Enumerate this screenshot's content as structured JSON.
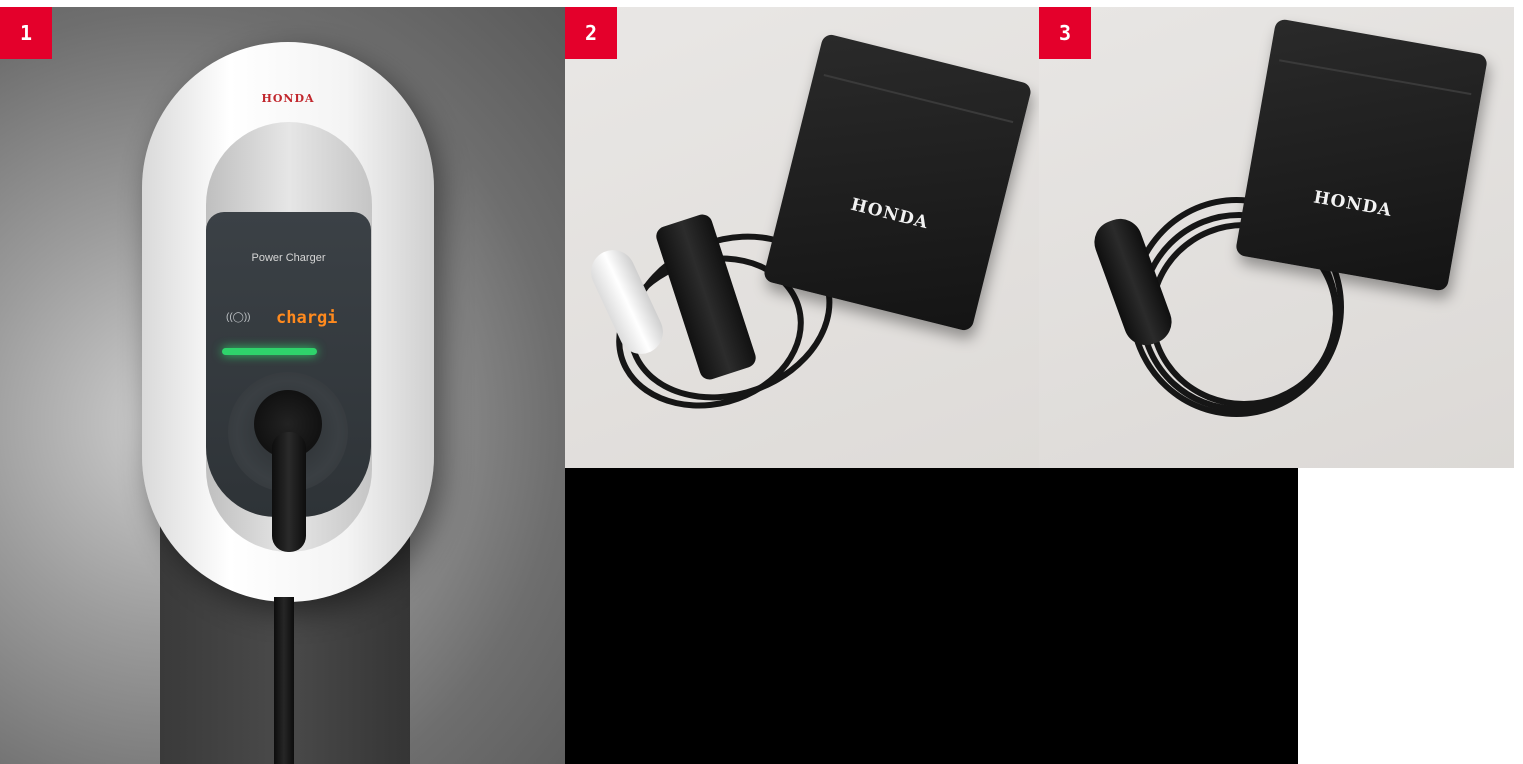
{
  "gallery": {
    "items": [
      {
        "number": "1",
        "brand_text": "HONDA",
        "device_label": "Power Charger",
        "status_icon": "wireless-icon",
        "status_glyph": "((◯))",
        "display_text": "chargi"
      },
      {
        "number": "2",
        "bag_brand": "HONDA"
      },
      {
        "number": "3",
        "bag_brand": "HONDA"
      }
    ]
  },
  "colors": {
    "badge": "#e4002b",
    "led_text": "#ff8a1e",
    "led_bar": "#2fd36b"
  }
}
